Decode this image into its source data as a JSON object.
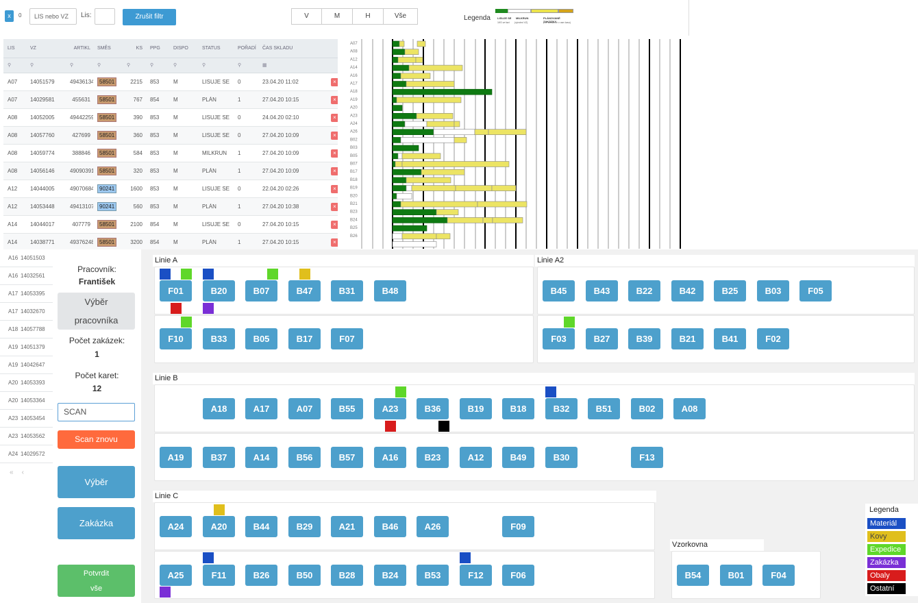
{
  "filter": {
    "x_label": "x",
    "count": "0",
    "search_placeholder": "LIS nebo VZ",
    "lis_label": "Lis:",
    "clear_label": "Zrušit filtr",
    "views": [
      "V",
      "M",
      "H",
      "Vše"
    ],
    "legend_label": "Legenda",
    "legend_parts": [
      "LISUJE SE",
      "MILKRUN",
      "PLÁNOVANÉ ZAKÁZKY"
    ],
    "legend_subs": [
      "1KS ve fazi",
      "(výrobní VZ)",
      "(VZ seřazené v ose času)"
    ]
  },
  "table": {
    "headers": [
      "LIS",
      "VZ",
      "ARTIKL",
      "SMĚS",
      "KS",
      "PPG",
      "DISPO",
      "STATUS",
      "POŘADÍ",
      "ČAS SKLADU"
    ],
    "rows": [
      [
        "A07",
        "14051579",
        "49436134",
        "58501",
        "2215",
        "853",
        "M",
        "LISUJE SE",
        "0",
        "23.04.20 11:02"
      ],
      [
        "A07",
        "14029581",
        "455631",
        "58501",
        "767",
        "854",
        "M",
        "PLÁN",
        "1",
        "27.04.20 10:15"
      ],
      [
        "A08",
        "14052005",
        "49442259",
        "58501",
        "390",
        "853",
        "M",
        "LISUJE SE",
        "0",
        "24.04.20 02:10"
      ],
      [
        "A08",
        "14057760",
        "427699",
        "58501",
        "360",
        "853",
        "M",
        "LISUJE SE",
        "0",
        "27.04.20 10:09"
      ],
      [
        "A08",
        "14059774",
        "388846",
        "58501",
        "584",
        "853",
        "M",
        "MILKRUN",
        "1",
        "27.04.20 10:09"
      ],
      [
        "A08",
        "14056146",
        "49090391",
        "58501",
        "320",
        "853",
        "M",
        "PLÁN",
        "1",
        "27.04.20 10:09"
      ],
      [
        "A12",
        "14044005",
        "49070684",
        "90241",
        "1600",
        "853",
        "M",
        "LISUJE SE",
        "0",
        "22.04.20 02:26"
      ],
      [
        "A12",
        "14053448",
        "49413107",
        "90241",
        "560",
        "853",
        "M",
        "PLÁN",
        "1",
        "27.04.20 10:38"
      ],
      [
        "A14",
        "14044017",
        "407779",
        "58501",
        "2100",
        "854",
        "M",
        "LISUJE SE",
        "0",
        "27.04.20 10:15"
      ],
      [
        "A14",
        "14038771",
        "49376248",
        "58501",
        "3200",
        "854",
        "M",
        "PLÁN",
        "1",
        "27.04.20 10:15"
      ]
    ],
    "left_rows": [
      [
        "A16",
        "14051503"
      ],
      [
        "A16",
        "14032561"
      ],
      [
        "A17",
        "14053395"
      ],
      [
        "A17",
        "14032670"
      ],
      [
        "A18",
        "14057788"
      ],
      [
        "A19",
        "14051379"
      ],
      [
        "A19",
        "14042647"
      ],
      [
        "A20",
        "14053393"
      ],
      [
        "A20",
        "14053364"
      ],
      [
        "A23",
        "14053454"
      ],
      [
        "A23",
        "14053562"
      ],
      [
        "A24",
        "14029572"
      ]
    ],
    "pager": [
      "«",
      "‹"
    ]
  },
  "gantt": {
    "labels": [
      "A07",
      "A08",
      "A12",
      "A14",
      "A16",
      "A17",
      "A18",
      "A19",
      "A20",
      "A23",
      "A24",
      "A26",
      "B02",
      "B03",
      "B05",
      "B07",
      "B17",
      "B18",
      "B19",
      "B20",
      "B21",
      "B23",
      "B24",
      "B25",
      "B26"
    ],
    "bars": [
      [
        [
          0,
          10,
          "g"
        ],
        [
          10,
          17,
          "y"
        ],
        [
          36,
          48,
          "y"
        ]
      ],
      [
        [
          0,
          18,
          "g"
        ],
        [
          18,
          38,
          "y"
        ]
      ],
      [
        [
          0,
          8,
          "g"
        ],
        [
          8,
          34,
          "y"
        ],
        [
          34,
          44,
          "y"
        ]
      ],
      [
        [
          0,
          24,
          "g"
        ],
        [
          24,
          102,
          "y"
        ]
      ],
      [
        [
          0,
          12,
          "g"
        ],
        [
          12,
          55,
          "y"
        ]
      ],
      [
        [
          0,
          20,
          "g"
        ],
        [
          20,
          90,
          "y"
        ]
      ],
      [
        [
          0,
          145,
          "g"
        ]
      ],
      [
        [
          0,
          6,
          "g"
        ],
        [
          6,
          100,
          "y"
        ]
      ],
      [
        [
          0,
          14,
          "g"
        ]
      ],
      [
        [
          0,
          35,
          "g"
        ],
        [
          35,
          88,
          "y"
        ]
      ],
      [
        [
          0,
          18,
          "g"
        ],
        [
          18,
          50,
          "w"
        ],
        [
          50,
          90,
          "y"
        ],
        [
          90,
          98,
          "y"
        ]
      ],
      [
        [
          0,
          60,
          "g"
        ],
        [
          60,
          120,
          "w"
        ],
        [
          120,
          140,
          "y"
        ],
        [
          140,
          195,
          "y"
        ]
      ],
      [
        [
          0,
          12,
          "g"
        ],
        [
          12,
          90,
          "w"
        ],
        [
          90,
          108,
          "y"
        ]
      ],
      [
        [
          0,
          38,
          "g"
        ]
      ],
      [
        [
          0,
          8,
          "g"
        ],
        [
          8,
          14,
          "w"
        ],
        [
          14,
          70,
          "y"
        ]
      ],
      [
        [
          0,
          4,
          "g"
        ],
        [
          4,
          14,
          "y"
        ],
        [
          14,
          170,
          "y"
        ]
      ],
      [
        [
          0,
          42,
          "g"
        ],
        [
          42,
          105,
          "y"
        ]
      ],
      [
        [
          0,
          20,
          "g"
        ],
        [
          20,
          85,
          "y"
        ]
      ],
      [
        [
          0,
          20,
          "g"
        ],
        [
          20,
          28,
          "w"
        ],
        [
          28,
          92,
          "y"
        ],
        [
          92,
          145,
          "y"
        ],
        [
          145,
          180,
          "y"
        ]
      ],
      [
        [
          0,
          6,
          "g"
        ],
        [
          6,
          28,
          "w"
        ]
      ],
      [
        [
          0,
          12,
          "g"
        ],
        [
          12,
          124,
          "y"
        ],
        [
          124,
          196,
          "y"
        ]
      ],
      [
        [
          0,
          64,
          "g"
        ],
        [
          64,
          96,
          "y"
        ]
      ],
      [
        [
          0,
          80,
          "g"
        ],
        [
          80,
          132,
          "y"
        ],
        [
          132,
          146,
          "y"
        ],
        [
          146,
          190,
          "y"
        ]
      ],
      [
        [
          0,
          50,
          "g"
        ]
      ],
      [
        [
          0,
          14,
          "w"
        ],
        [
          14,
          64,
          "y"
        ],
        [
          64,
          84,
          "y"
        ]
      ],
      [
        [
          0,
          64,
          "w"
        ]
      ]
    ]
  },
  "sidebar": {
    "worker_label": "Pracovník:",
    "worker_name": "František",
    "select_worker": "Výběr pracovníka",
    "orders_label": "Počet zakázek:",
    "orders_value": "1",
    "cards_label": "Počet karet:",
    "cards_value": "12",
    "scan_placeholder": "SCAN",
    "scan_again": "Scan znovu",
    "select": "Výběr",
    "order": "Zakázka",
    "confirm": "Potvrdit vše"
  },
  "lines": {
    "lineA": {
      "label": "Linie A",
      "row1": [
        "F01",
        "B20",
        "B07",
        "B47",
        "B31",
        "B48"
      ],
      "row2": [
        "F10",
        "B33",
        "B05",
        "B17",
        "F07"
      ]
    },
    "lineA2": {
      "label": "Linie A2",
      "row1": [
        "B45",
        "B43",
        "B22",
        "B42",
        "B25",
        "B03",
        "F05"
      ],
      "row2": [
        "F03",
        "B27",
        "B39",
        "B21",
        "B41",
        "F02"
      ]
    },
    "lineB": {
      "label": "Linie B",
      "row1": [
        "A18",
        "A17",
        "A07",
        "B55",
        "A23",
        "B36",
        "B19",
        "B18",
        "B32",
        "B51",
        "B02",
        "A08"
      ],
      "row2": [
        "A19",
        "B37",
        "A14",
        "B56",
        "B57",
        "A16",
        "B23",
        "A12",
        "B49",
        "B30",
        "F13"
      ]
    },
    "lineC": {
      "label": "Linie C",
      "row1": [
        "A24",
        "A20",
        "B44",
        "B29",
        "A21",
        "B46",
        "A26",
        "F09"
      ],
      "row2": [
        "A25",
        "F11",
        "B26",
        "B50",
        "B28",
        "B24",
        "B53",
        "F12",
        "F06"
      ]
    },
    "vzorkovna": {
      "label": "Vzorkovna",
      "items": [
        "B54",
        "B01",
        "F04"
      ]
    }
  },
  "legend": {
    "title": "Legenda",
    "items": [
      {
        "label": "Materiál",
        "color": "#1a4fc4"
      },
      {
        "label": "Kovy",
        "color": "#e0bf1c"
      },
      {
        "label": "Expedice",
        "color": "#5fd72a"
      },
      {
        "label": "Zakázka",
        "color": "#7a2fd6"
      },
      {
        "label": "Obaly",
        "color": "#d81c1c"
      },
      {
        "label": "Ostatní",
        "color": "#000000"
      }
    ]
  }
}
